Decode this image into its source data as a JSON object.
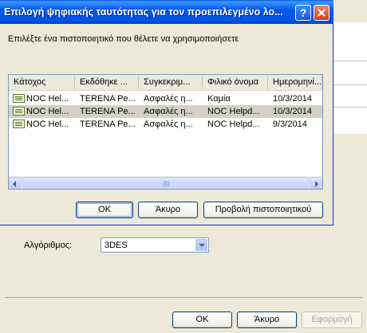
{
  "dialog": {
    "title": "Επιλογή ψηφιακής ταυτότητας για τον προεπιλεγμένο λο...",
    "help_label": "?",
    "prompt": "Επιλέξτε ένα πιστοποιητικό που θέλετε να χρησιμοποιήσετε",
    "columns": [
      "Κάτοχος",
      "Εκδόθηκε ...",
      "Συγκεκριμ...",
      "Φιλικό όνομα",
      "Ημερομηνί..."
    ],
    "rows": [
      {
        "icon": "certificate-icon",
        "cells": [
          "NOC Hel...",
          "TERENA Pe...",
          "Ασφαλές η...",
          "Καμία",
          "10/3/2014"
        ],
        "selected": false
      },
      {
        "icon": "certificate-icon",
        "cells": [
          "NOC Hel...",
          "TERENA Pe...",
          "Ασφαλές η...",
          "NOC Helpd...",
          "10/3/2014"
        ],
        "selected": true
      },
      {
        "icon": "certificate-icon",
        "cells": [
          "NOC Hel...",
          "TERENA Pe...",
          "Ασφαλές η...",
          "NOC Helpd...",
          "9/3/2014"
        ],
        "selected": false
      }
    ],
    "scroll_grip": "|||",
    "buttons": {
      "ok": "OK",
      "cancel": "Άκυρο",
      "view": "Προβολή πιστοποιητικού"
    }
  },
  "background": {
    "algorithm_label": "Αλγόριθμος:",
    "algorithm_value": "3DES",
    "buttons": {
      "ok": "OK",
      "cancel": "Άκυρο",
      "apply": "Εφαρμογή"
    }
  },
  "colors": {
    "titlebar": "#0058ee",
    "selection": "#d4d0c8",
    "dialog_bg": "#ece9d8"
  }
}
